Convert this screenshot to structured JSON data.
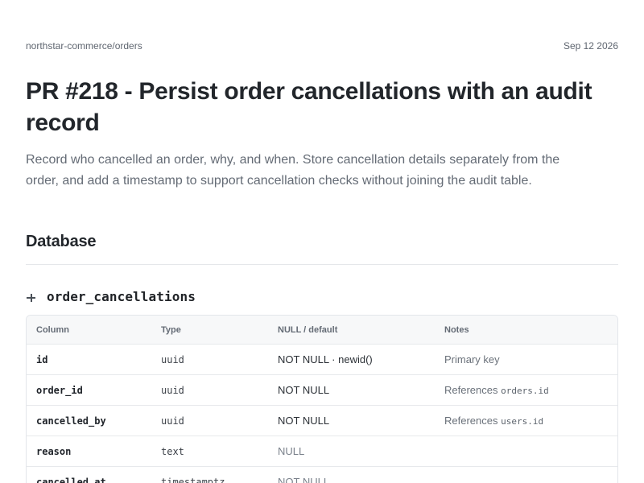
{
  "header": {
    "repo": "northstar-commerce/orders",
    "date": "Sep 12 2026"
  },
  "pr": {
    "title": "PR #218 - Persist order cancellations with an audit record",
    "description": "Record who cancelled an order, why, and when. Store cancellation details separately from the order, and add a timestamp to support cancellation checks without joining the audit table."
  },
  "database": {
    "section_title": "Database",
    "table": {
      "icon": "plus-icon",
      "name": "order_cancellations",
      "columns": {
        "column": "Column",
        "type": "Type",
        "null_default": "NULL / default",
        "notes": "Notes"
      },
      "rows": [
        {
          "column": "id",
          "type": "uuid",
          "null_default": "NOT NULL · newid()",
          "notes_text": "Primary key",
          "notes_code": ""
        },
        {
          "column": "order_id",
          "type": "uuid",
          "null_default": "NOT NULL",
          "notes_text": "References",
          "notes_code": "orders.id"
        },
        {
          "column": "cancelled_by",
          "type": "uuid",
          "null_default": "NOT NULL",
          "notes_text": "References",
          "notes_code": "users.id"
        },
        {
          "column": "reason",
          "type": "text",
          "null_default": "NULL",
          "notes_text": "",
          "notes_code": ""
        },
        {
          "column": "cancelled_at",
          "type": "timestamptz",
          "null_default": "NOT NULL",
          "notes_text": "",
          "notes_code": ""
        }
      ]
    }
  }
}
